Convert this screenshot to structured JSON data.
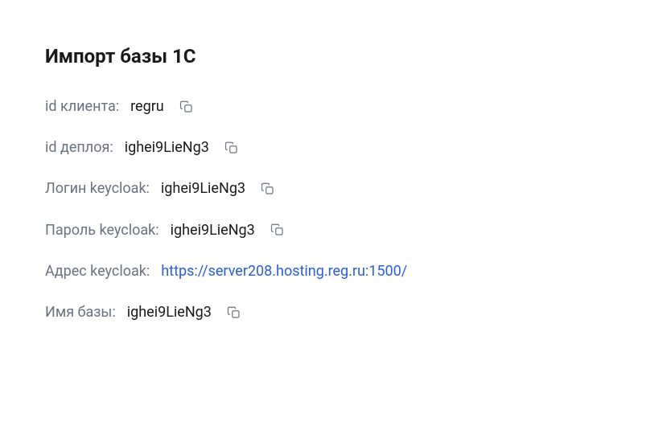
{
  "title": "Импорт базы 1С",
  "rows": {
    "clientId": {
      "label": "id клиента:",
      "value": "regru"
    },
    "deployId": {
      "label": "id деплоя:",
      "value": "ighei9LieNg3"
    },
    "keycloakLogin": {
      "label": "Логин keycloak:",
      "value": "ighei9LieNg3"
    },
    "keycloakPass": {
      "label": "Пароль keycloak:",
      "value": "ighei9LieNg3"
    },
    "keycloakAddr": {
      "label": "Адрес keycloak:",
      "value": "https://server208.hosting.reg.ru:1500/"
    },
    "dbName": {
      "label": "Имя базы:",
      "value": "ighei9LieNg3"
    }
  }
}
